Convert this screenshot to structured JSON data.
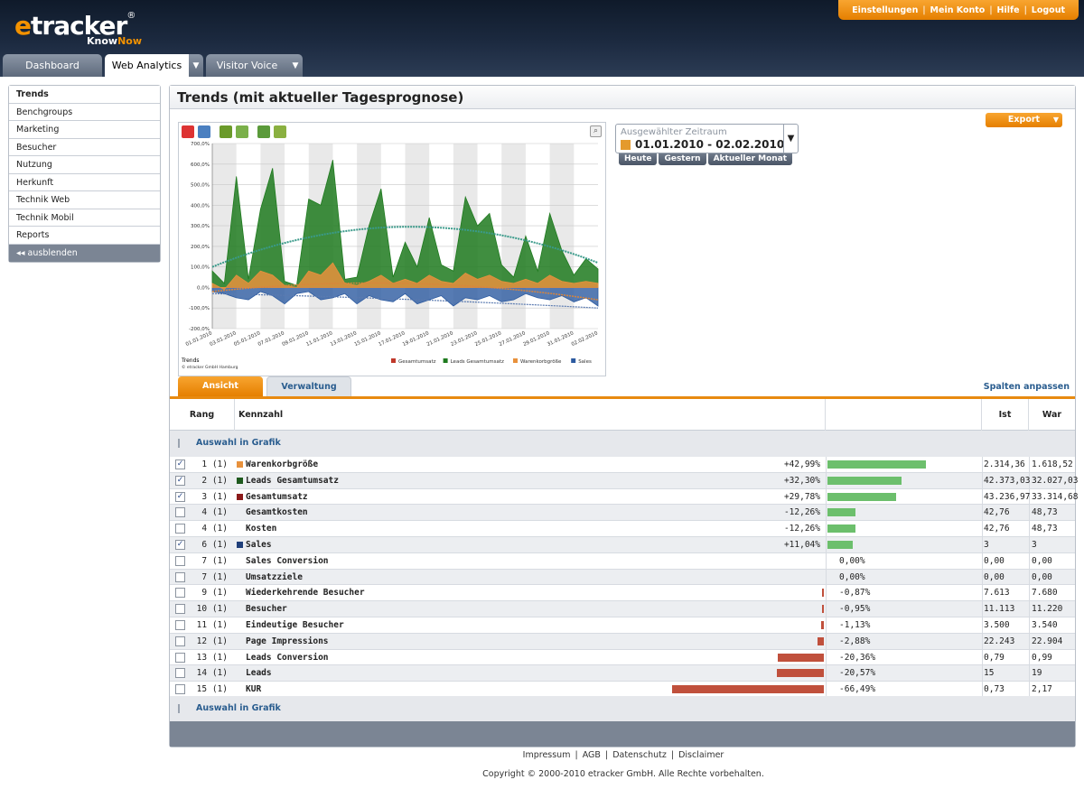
{
  "header": {
    "logo_text": "etracker",
    "logo_tagline_1": "Know",
    "logo_tagline_2": "Now",
    "menu": [
      "Einstellungen",
      "Mein Konto",
      "Hilfe",
      "Logout"
    ]
  },
  "tabs": [
    {
      "label": "Dashboard",
      "active": false,
      "dropdown": false
    },
    {
      "label": "Web Analytics",
      "active": true,
      "dropdown": true
    },
    {
      "label": "Visitor Voice",
      "active": false,
      "dropdown": true
    }
  ],
  "sidebar": {
    "items": [
      "Trends",
      "Benchgroups",
      "Marketing",
      "Besucher",
      "Nutzung",
      "Herkunft",
      "Technik Web",
      "Technik Mobil",
      "Reports"
    ],
    "active": "Trends",
    "hide_label": "◂◂ ausblenden"
  },
  "panel": {
    "title": "Trends (mit aktueller Tagesprognose)",
    "export_label": "Export"
  },
  "zeitraum": {
    "label": "Ausgewählter Zeitraum",
    "value": "01.01.2010 - 02.02.2010",
    "buttons": [
      "Heute",
      "Gestern",
      "Aktueller Monat"
    ]
  },
  "subtabs": {
    "ansicht": "Ansicht",
    "verwaltung": "Verwaltung",
    "spalten": "Spalten anpassen"
  },
  "table": {
    "headers": {
      "rang": "Rang",
      "kennzahl": "Kennzahl",
      "ist": "Ist",
      "war": "War"
    },
    "auswahl_label": "Auswahl in Grafik",
    "rows": [
      {
        "rank": "1 (1)",
        "name": "Warenkorbgröße",
        "checked": true,
        "color": "#e8913c",
        "pct": "+42,99%",
        "val": 42.99,
        "ist": "2.314,36",
        "war": "1.618,52"
      },
      {
        "rank": "2 (1)",
        "name": "Leads Gesamtumsatz",
        "checked": true,
        "color": "#1e5a1e",
        "pct": "+32,30%",
        "val": 32.3,
        "ist": "42.373,03",
        "war": "32.027,03"
      },
      {
        "rank": "3 (1)",
        "name": "Gesamtumsatz",
        "checked": true,
        "color": "#8b1a1a",
        "pct": "+29,78%",
        "val": 29.78,
        "ist": "43.236,97",
        "war": "33.314,68"
      },
      {
        "rank": "4 (1)",
        "name": "Gesamtkosten",
        "checked": false,
        "color": "",
        "pct": "-12,26%",
        "val": 12.26,
        "ist": "42,76",
        "war": "48,73"
      },
      {
        "rank": "4 (1)",
        "name": "Kosten",
        "checked": false,
        "color": "",
        "pct": "-12,26%",
        "val": 12.26,
        "ist": "42,76",
        "war": "48,73"
      },
      {
        "rank": "6 (1)",
        "name": "Sales",
        "checked": true,
        "color": "#1f3f7a",
        "pct": "+11,04%",
        "val": 11.04,
        "ist": "3",
        "war": "3"
      },
      {
        "rank": "7 (1)",
        "name": "Sales Conversion",
        "checked": false,
        "color": "",
        "pct": "0,00%",
        "val": 0,
        "ist": "0,00",
        "war": "0,00"
      },
      {
        "rank": "7 (1)",
        "name": "Umsatzziele",
        "checked": false,
        "color": "",
        "pct": "0,00%",
        "val": 0,
        "ist": "0,00",
        "war": "0,00"
      },
      {
        "rank": "9 (1)",
        "name": "Wiederkehrende Besucher",
        "checked": false,
        "color": "",
        "pct": "-0,87%",
        "val": -0.87,
        "ist": "7.613",
        "war": "7.680"
      },
      {
        "rank": "10 (1)",
        "name": "Besucher",
        "checked": false,
        "color": "",
        "pct": "-0,95%",
        "val": -0.95,
        "ist": "11.113",
        "war": "11.220"
      },
      {
        "rank": "11 (1)",
        "name": "Eindeutige Besucher",
        "checked": false,
        "color": "",
        "pct": "-1,13%",
        "val": -1.13,
        "ist": "3.500",
        "war": "3.540"
      },
      {
        "rank": "12 (1)",
        "name": "Page Impressions",
        "checked": false,
        "color": "",
        "pct": "-2,88%",
        "val": -2.88,
        "ist": "22.243",
        "war": "22.904"
      },
      {
        "rank": "13 (1)",
        "name": "Leads Conversion",
        "checked": false,
        "color": "",
        "pct": "-20,36%",
        "val": -20.36,
        "ist": "0,79",
        "war": "0,99"
      },
      {
        "rank": "14 (1)",
        "name": "Leads",
        "checked": false,
        "color": "",
        "pct": "-20,57%",
        "val": -20.57,
        "ist": "15",
        "war": "19"
      },
      {
        "rank": "15 (1)",
        "name": "KUR",
        "checked": false,
        "color": "",
        "pct": "-66,49%",
        "val": -66.49,
        "ist": "0,73",
        "war": "2,17"
      }
    ]
  },
  "footer": {
    "links": [
      "Impressum",
      "AGB",
      "Datenschutz",
      "Disclaimer"
    ],
    "copyright": "Copyright © 2000-2010 etracker GmbH. Alle Rechte vorbehalten."
  },
  "chart_data": {
    "type": "area",
    "title": "Trends",
    "credit": "© etracker GmbH Hamburg",
    "ylim": [
      -200,
      700
    ],
    "yticks": [
      "700,0%",
      "600,0%",
      "500,0%",
      "400,0%",
      "300,0%",
      "200,0%",
      "100,0%",
      "0,0%",
      "-100,0%",
      "-200,0%"
    ],
    "x": [
      "01.01.2010",
      "03.01.2010",
      "05.01.2010",
      "07.01.2010",
      "09.01.2010",
      "11.01.2010",
      "13.01.2010",
      "15.01.2010",
      "17.01.2010",
      "19.01.2010",
      "21.01.2010",
      "23.01.2010",
      "25.01.2010",
      "27.01.2010",
      "29.01.2010",
      "31.01.2010",
      "02.02.2010"
    ],
    "series": [
      {
        "name": "Gesamtumsatz",
        "color": "#c0392b"
      },
      {
        "name": "Leads Gesamtumsatz",
        "color": "#1e7a1e",
        "values": [
          80,
          20,
          540,
          40,
          380,
          580,
          30,
          10,
          430,
          400,
          620,
          40,
          50,
          300,
          480,
          50,
          220,
          100,
          340,
          110,
          80,
          440,
          300,
          360,
          110,
          50,
          250,
          80,
          360,
          180,
          60,
          140,
          90
        ]
      },
      {
        "name": "Warenkorbgröße",
        "color": "#e8913c",
        "values": [
          20,
          -10,
          60,
          20,
          80,
          60,
          10,
          0,
          80,
          60,
          120,
          20,
          10,
          30,
          60,
          20,
          40,
          20,
          60,
          30,
          20,
          70,
          40,
          60,
          30,
          20,
          40,
          20,
          60,
          30,
          20,
          30,
          20
        ]
      },
      {
        "name": "Sales",
        "color": "#2c5aa0",
        "values": [
          -20,
          -30,
          -50,
          -60,
          -20,
          -40,
          -80,
          -30,
          -20,
          -60,
          -50,
          -30,
          -80,
          -40,
          -60,
          -70,
          -30,
          -80,
          -60,
          -40,
          -90,
          -50,
          -60,
          -40,
          -70,
          -60,
          -30,
          -50,
          -60,
          -40,
          -70,
          -50,
          -90
        ]
      }
    ]
  }
}
